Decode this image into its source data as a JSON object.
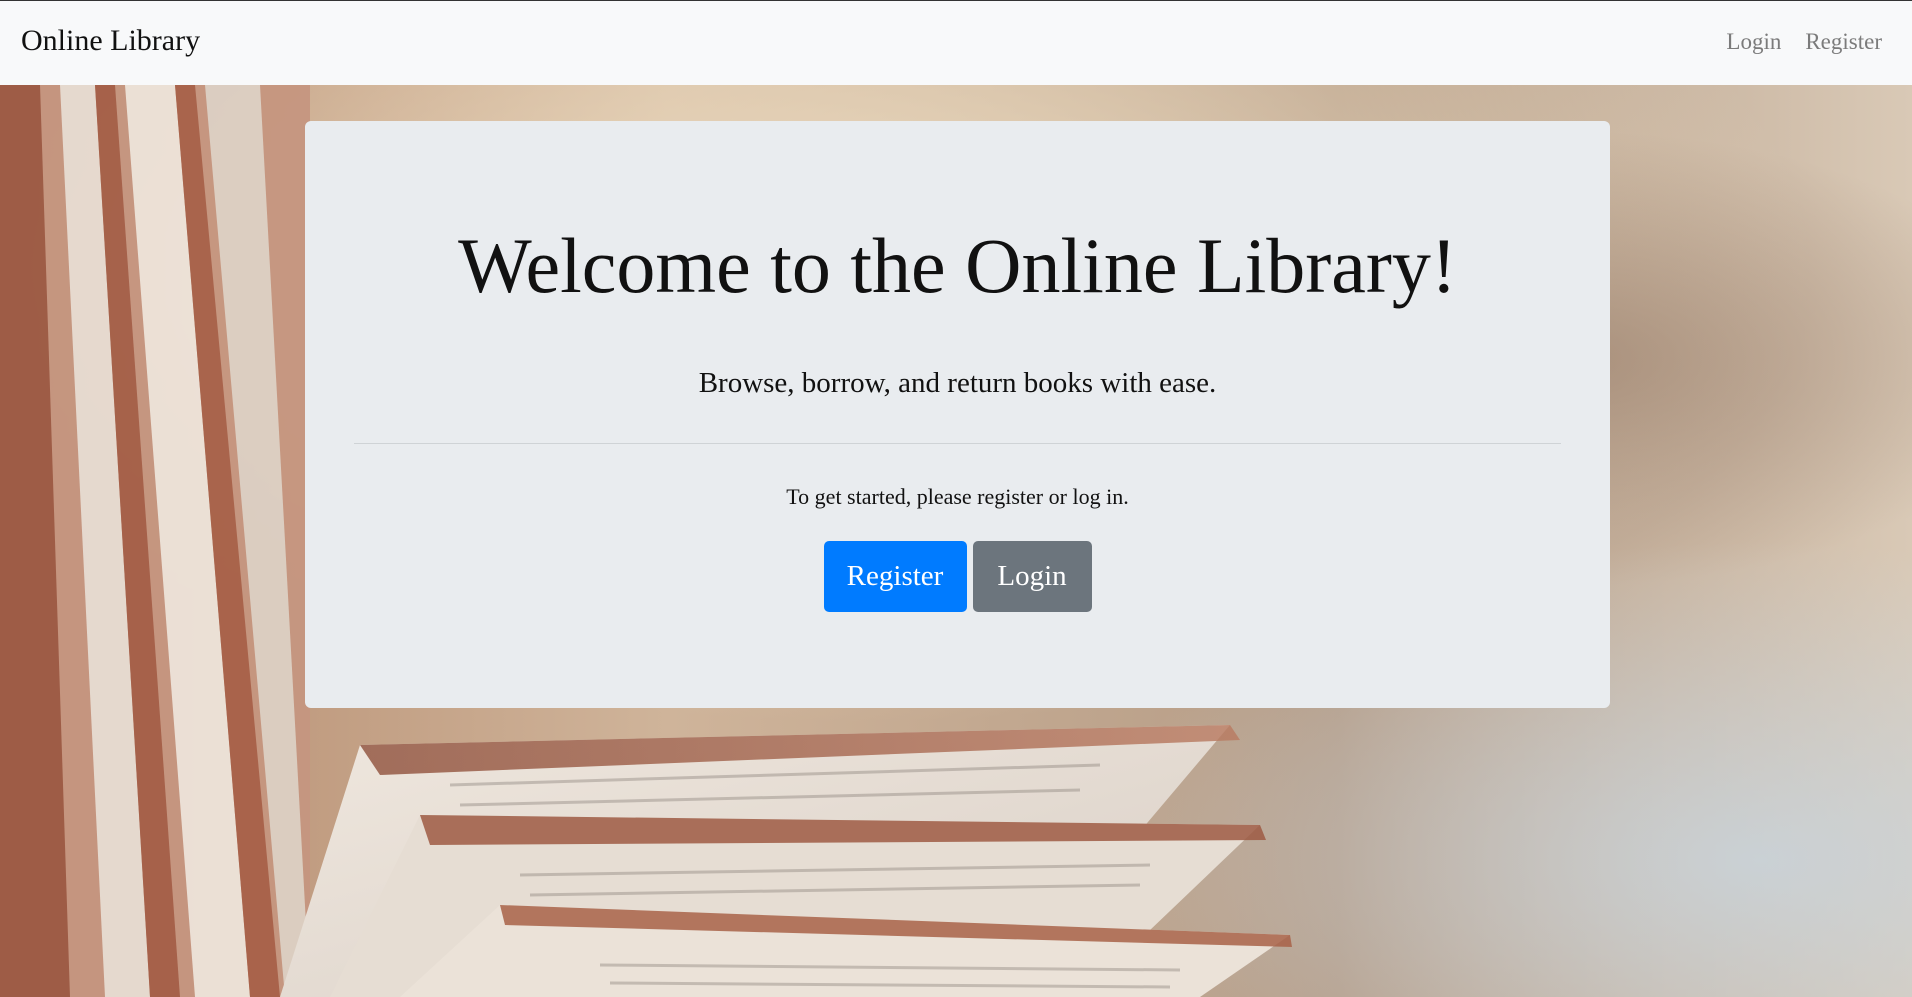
{
  "navbar": {
    "brand": "Online Library",
    "links": [
      {
        "label": "Login"
      },
      {
        "label": "Register"
      }
    ]
  },
  "hero": {
    "title": "Welcome to the Online Library!",
    "lead": "Browse, borrow, and return books with ease.",
    "prompt": "To get started, please register or log in.",
    "register_label": "Register",
    "login_label": "Login"
  },
  "colors": {
    "navbar_bg": "#f8f9fa",
    "card_bg": "#e9ecef",
    "primary": "#007bff",
    "secondary": "#6c757d",
    "nav_link": "#7b7b7b"
  }
}
